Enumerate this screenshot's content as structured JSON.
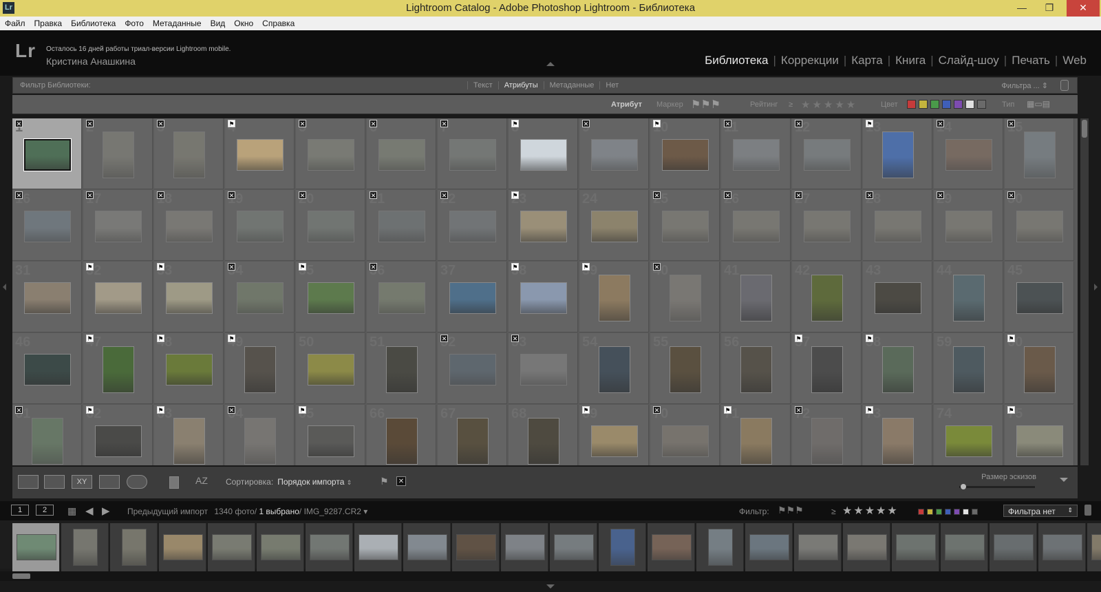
{
  "window": {
    "title": "Lightroom Catalog - Adobe Photoshop Lightroom - Библиотека",
    "app_icon": "Lr",
    "controls": [
      "—",
      "❐",
      "✕"
    ]
  },
  "menu": [
    "Файл",
    "Правка",
    "Библиотека",
    "Фото",
    "Метаданные",
    "Вид",
    "Окно",
    "Справка"
  ],
  "identity": {
    "logo": "Lr",
    "trial": "Осталось 16 дней работы триал-версии Lightroom mobile.",
    "user": "Кристина Анашкина"
  },
  "modules": [
    {
      "label": "Библиотека",
      "active": true
    },
    {
      "label": "Коррекции"
    },
    {
      "label": "Карта"
    },
    {
      "label": "Книга"
    },
    {
      "label": "Слайд-шоу"
    },
    {
      "label": "Печать"
    },
    {
      "label": "Web"
    }
  ],
  "filter_bar": {
    "label": "Фильтр Библиотеки:",
    "tabs": [
      {
        "label": "Текст"
      },
      {
        "label": "Атрибуты",
        "active": true
      },
      {
        "label": "Метаданные"
      },
      {
        "label": "Нет"
      }
    ],
    "preset": "Фильтра ... ⇕"
  },
  "attribute_bar": {
    "attribute": "Атрибут",
    "marker": "Маркер",
    "rating": "Рейтинг",
    "rating_op": "≥",
    "stars": "★★★★★",
    "color": "Цвет",
    "type": "Тип",
    "color_chips": [
      "#c53b3b",
      "#c4b43d",
      "#4a9a4a",
      "#3f5fb8",
      "#7d4cb0",
      "#e0e0e0",
      "#6a6a6a"
    ]
  },
  "grid": {
    "cells": [
      {
        "n": "1",
        "flag": "x",
        "o": "l",
        "c": "#4f6f57",
        "sel": true
      },
      {
        "n": "2",
        "flag": "x",
        "o": "p",
        "c": "#8a8a80",
        "dim": true
      },
      {
        "n": "3",
        "flag": "x",
        "o": "p",
        "c": "#8b8a7c",
        "dim": true
      },
      {
        "n": "4",
        "flag": "p",
        "o": "l",
        "c": "#b9a27a"
      },
      {
        "n": "5",
        "flag": "x",
        "o": "l",
        "c": "#8e9184",
        "dim": true
      },
      {
        "n": "6",
        "flag": "x",
        "o": "l",
        "c": "#8b9181",
        "dim": true
      },
      {
        "n": "7",
        "flag": "x",
        "o": "l",
        "c": "#858b86",
        "dim": true
      },
      {
        "n": "8",
        "flag": "p",
        "o": "l",
        "c": "#cfd6dc"
      },
      {
        "n": "9",
        "flag": "x",
        "o": "l",
        "c": "#9aa3ac",
        "dim": true
      },
      {
        "n": "10",
        "flag": "p",
        "o": "l",
        "c": "#6d5a48"
      },
      {
        "n": "11",
        "flag": "x",
        "o": "l",
        "c": "#949aa0",
        "dim": true
      },
      {
        "n": "12",
        "flag": "x",
        "o": "l",
        "c": "#8a9296",
        "dim": true
      },
      {
        "n": "13",
        "flag": "p",
        "o": "p",
        "c": "#4e6fa8"
      },
      {
        "n": "14",
        "flag": "x",
        "o": "l",
        "c": "#8a7060",
        "dim": true
      },
      {
        "n": "15",
        "flag": "x",
        "o": "p",
        "c": "#88949c",
        "dim": true
      },
      {
        "n": "16",
        "flag": "x",
        "o": "l",
        "c": "#7b8a96",
        "dim": true
      },
      {
        "n": "17",
        "flag": "x",
        "o": "l",
        "c": "#8f8f8a",
        "dim": true
      },
      {
        "n": "18",
        "flag": "x",
        "o": "l",
        "c": "#8f8c84",
        "dim": true
      },
      {
        "n": "19",
        "flag": "x",
        "o": "l",
        "c": "#7e8680",
        "dim": true
      },
      {
        "n": "20",
        "flag": "x",
        "o": "l",
        "c": "#7e8680",
        "dim": true
      },
      {
        "n": "21",
        "flag": "x",
        "o": "l",
        "c": "#777e80",
        "dim": true
      },
      {
        "n": "22",
        "flag": "x",
        "o": "l",
        "c": "#7e8488",
        "dim": true
      },
      {
        "n": "23",
        "flag": "p",
        "o": "l",
        "c": "#9a8f78"
      },
      {
        "n": "24",
        "flag": "",
        "o": "l",
        "c": "#8c836c"
      },
      {
        "n": "25",
        "flag": "x",
        "o": "l",
        "c": "#8d8b80",
        "dim": true
      },
      {
        "n": "26",
        "flag": "x",
        "o": "l",
        "c": "#8d8b80",
        "dim": true
      },
      {
        "n": "27",
        "flag": "x",
        "o": "l",
        "c": "#8d8b80",
        "dim": true
      },
      {
        "n": "28",
        "flag": "x",
        "o": "l",
        "c": "#8d8b80",
        "dim": true
      },
      {
        "n": "29",
        "flag": "x",
        "o": "l",
        "c": "#8d8b80",
        "dim": true
      },
      {
        "n": "30",
        "flag": "x",
        "o": "l",
        "c": "#8d8b80",
        "dim": true
      },
      {
        "n": "31",
        "flag": "",
        "o": "l",
        "c": "#8a7f70"
      },
      {
        "n": "32",
        "flag": "p",
        "o": "l",
        "c": "#a29a88"
      },
      {
        "n": "33",
        "flag": "p",
        "o": "l",
        "c": "#9e9a86"
      },
      {
        "n": "34",
        "flag": "x",
        "o": "l",
        "c": "#7c8a70",
        "dim": true
      },
      {
        "n": "35",
        "flag": "p",
        "o": "l",
        "c": "#5d7a4d"
      },
      {
        "n": "36",
        "flag": "x",
        "o": "l",
        "c": "#869078",
        "dim": true
      },
      {
        "n": "37",
        "flag": "",
        "o": "l",
        "c": "#4f6f8a"
      },
      {
        "n": "38",
        "flag": "p",
        "o": "l",
        "c": "#8a98ae"
      },
      {
        "n": "39",
        "flag": "p",
        "o": "p",
        "c": "#8c7a60"
      },
      {
        "n": "40",
        "flag": "x",
        "o": "p",
        "c": "#8f8a82",
        "dim": true
      },
      {
        "n": "41",
        "flag": "",
        "o": "p",
        "c": "#6a6a70"
      },
      {
        "n": "42",
        "flag": "",
        "o": "p",
        "c": "#5e6a3c"
      },
      {
        "n": "43",
        "flag": "",
        "o": "l",
        "c": "#4c4a44"
      },
      {
        "n": "44",
        "flag": "",
        "o": "p",
        "c": "#5a6a70"
      },
      {
        "n": "45",
        "flag": "",
        "o": "l",
        "c": "#4c5254"
      },
      {
        "n": "46",
        "flag": "",
        "o": "l",
        "c": "#3c4a48"
      },
      {
        "n": "47",
        "flag": "p",
        "o": "p",
        "c": "#4a6a3a"
      },
      {
        "n": "48",
        "flag": "p",
        "o": "l",
        "c": "#6a7a3a"
      },
      {
        "n": "49",
        "flag": "p",
        "o": "p",
        "c": "#56524c"
      },
      {
        "n": "50",
        "flag": "",
        "o": "l",
        "c": "#8c8a48"
      },
      {
        "n": "51",
        "flag": "",
        "o": "p",
        "c": "#4a4a44"
      },
      {
        "n": "52",
        "flag": "x",
        "o": "l",
        "c": "#5a6a78",
        "dim": true
      },
      {
        "n": "53",
        "flag": "x",
        "o": "l",
        "c": "#8a8a8a",
        "dim": true
      },
      {
        "n": "54",
        "flag": "",
        "o": "p",
        "c": "#45505a"
      },
      {
        "n": "55",
        "flag": "",
        "o": "p",
        "c": "#5a5040"
      },
      {
        "n": "56",
        "flag": "",
        "o": "p",
        "c": "#56524a"
      },
      {
        "n": "57",
        "flag": "p",
        "o": "p",
        "c": "#4c4c4c"
      },
      {
        "n": "58",
        "flag": "p",
        "o": "p",
        "c": "#5a6a5a"
      },
      {
        "n": "59",
        "flag": "",
        "o": "p",
        "c": "#4e5a60"
      },
      {
        "n": "60",
        "flag": "p",
        "o": "p",
        "c": "#6a5a4a"
      },
      {
        "n": "61",
        "flag": "x",
        "o": "p",
        "c": "#6a8a68",
        "dim": true
      },
      {
        "n": "62",
        "flag": "p",
        "o": "l",
        "c": "#4a4a48"
      },
      {
        "n": "63",
        "flag": "p",
        "o": "p",
        "c": "#8a8070"
      },
      {
        "n": "64",
        "flag": "x",
        "o": "p",
        "c": "#8a8680",
        "dim": true
      },
      {
        "n": "65",
        "flag": "p",
        "o": "l",
        "c": "#5a5a58"
      },
      {
        "n": "66",
        "flag": "",
        "o": "p",
        "c": "#5a4a38"
      },
      {
        "n": "67",
        "flag": "",
        "o": "p",
        "c": "#585040"
      },
      {
        "n": "68",
        "flag": "",
        "o": "p",
        "c": "#4e4a40"
      },
      {
        "n": "69",
        "flag": "p",
        "o": "l",
        "c": "#9a8a6a"
      },
      {
        "n": "70",
        "flag": "x",
        "o": "l",
        "c": "#8a8276",
        "dim": true
      },
      {
        "n": "71",
        "flag": "p",
        "o": "p",
        "c": "#8a7a60"
      },
      {
        "n": "72",
        "flag": "x",
        "o": "p",
        "c": "#7a7470",
        "dim": true
      },
      {
        "n": "73",
        "flag": "p",
        "o": "p",
        "c": "#8a7a68"
      },
      {
        "n": "74",
        "flag": "",
        "o": "l",
        "c": "#7a8a3a"
      },
      {
        "n": "75",
        "flag": "p",
        "o": "l",
        "c": "#8a8a7a"
      }
    ]
  },
  "toolbar": {
    "sort_label": "Сортировка:",
    "sort_value": "Порядок импорта",
    "thumb_size_label": "Размер эскизов"
  },
  "filmstrip_bar": {
    "screen1": "1",
    "screen2": "2",
    "source": "Предыдущий импорт",
    "count": "1340 фото",
    "selected": "1 выбрано",
    "file": "IMG_9287.CR2",
    "filter_label": "Фильтр:",
    "rating_op": "≥",
    "stars": "★★★★★",
    "filter_preset": "Фильтра нет",
    "chips": [
      "#c53b3b",
      "#c4b43d",
      "#4a9a4a",
      "#3f5fb8",
      "#7d4cb0",
      "#e0e0e0",
      "#6a6a6a"
    ]
  },
  "filmstrip": [
    {
      "c": "#6f8a74",
      "o": "l",
      "sel": true
    },
    {
      "c": "#8a8a80",
      "o": "p"
    },
    {
      "c": "#8b8a7c",
      "o": "p"
    },
    {
      "c": "#b9a27a",
      "o": "l"
    },
    {
      "c": "#8e9184",
      "o": "l"
    },
    {
      "c": "#8b9181",
      "o": "l"
    },
    {
      "c": "#858b86",
      "o": "l"
    },
    {
      "c": "#cfd6dc",
      "o": "l"
    },
    {
      "c": "#9aa3ac",
      "o": "l"
    },
    {
      "c": "#6d5a48",
      "o": "l"
    },
    {
      "c": "#949aa0",
      "o": "l"
    },
    {
      "c": "#8a9296",
      "o": "l"
    },
    {
      "c": "#4e6fa8",
      "o": "p"
    },
    {
      "c": "#8a7060",
      "o": "l"
    },
    {
      "c": "#88949c",
      "o": "p"
    },
    {
      "c": "#7b8a96",
      "o": "l"
    },
    {
      "c": "#8f8f8a",
      "o": "l"
    },
    {
      "c": "#8f8c84",
      "o": "l"
    },
    {
      "c": "#7e8680",
      "o": "l"
    },
    {
      "c": "#7e8680",
      "o": "l"
    },
    {
      "c": "#777e80",
      "o": "l"
    },
    {
      "c": "#7e8488",
      "o": "l"
    },
    {
      "c": "#9a8f78",
      "o": "l"
    }
  ]
}
